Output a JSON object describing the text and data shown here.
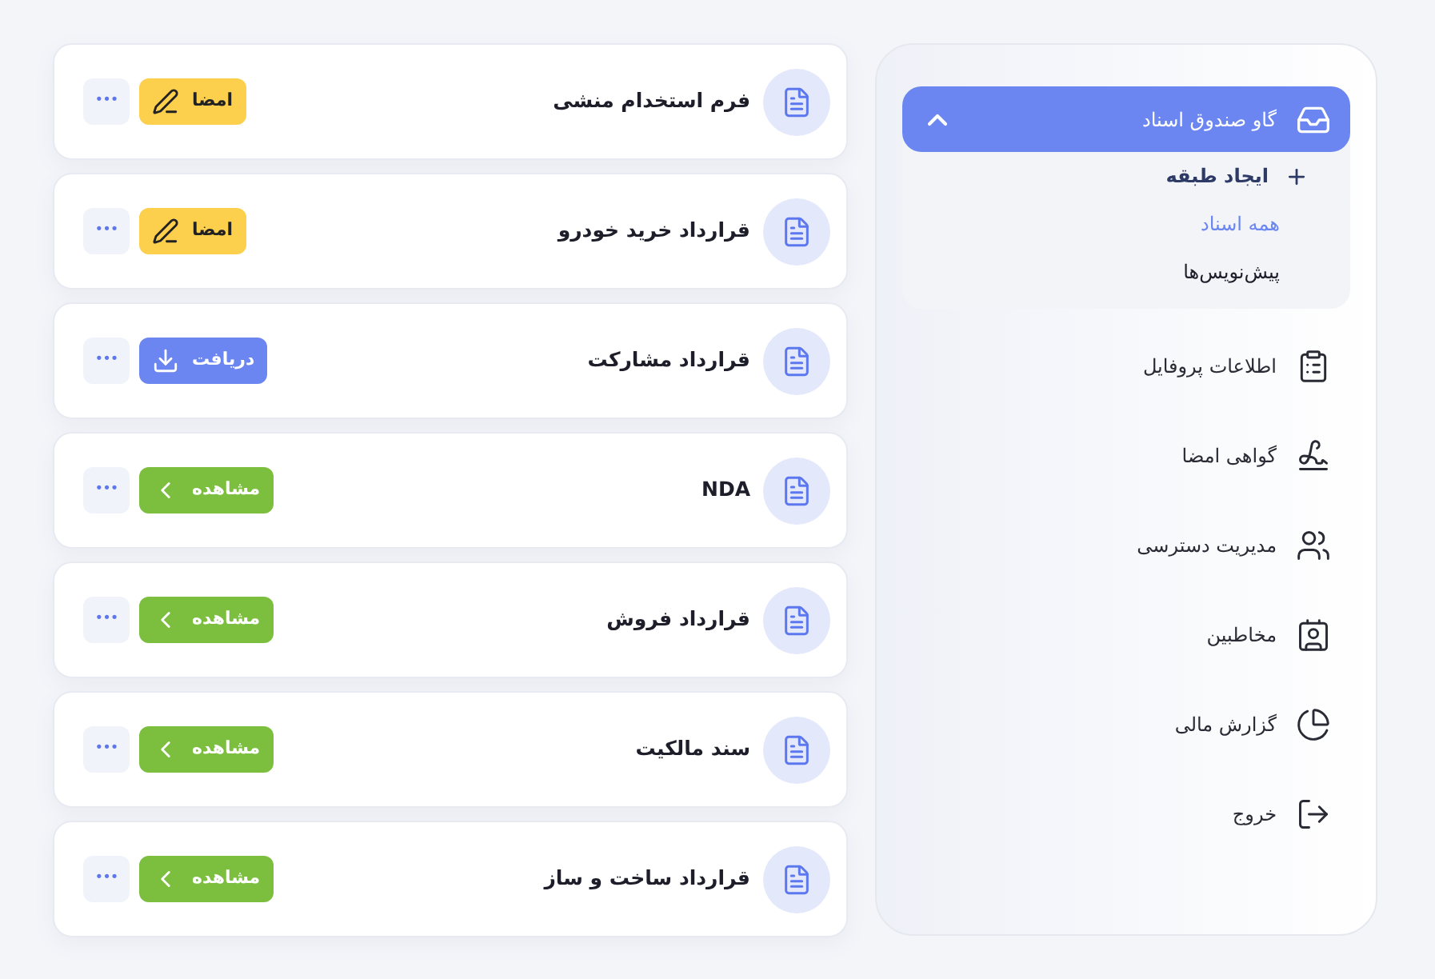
{
  "documents": [
    {
      "title": "فرم استخدام منشی",
      "action": {
        "kind": "sign",
        "label": "امضا"
      },
      "more": "•••"
    },
    {
      "title": "قرارداد خرید خودرو",
      "action": {
        "kind": "sign",
        "label": "امضا"
      },
      "more": "•••"
    },
    {
      "title": "قرارداد مشارکت",
      "action": {
        "kind": "download",
        "label": "دریافت"
      },
      "more": "•••"
    },
    {
      "title": "NDA",
      "action": {
        "kind": "view",
        "label": "مشاهده"
      },
      "more": "•••"
    },
    {
      "title": "قرارداد فروش",
      "action": {
        "kind": "view",
        "label": "مشاهده"
      },
      "more": "•••"
    },
    {
      "title": "سند مالکیت",
      "action": {
        "kind": "view",
        "label": "مشاهده"
      },
      "more": "•••"
    },
    {
      "title": "قرارداد ساخت و ساز",
      "action": {
        "kind": "view",
        "label": "مشاهده"
      },
      "more": "•••"
    }
  ],
  "sidebar": {
    "group": {
      "label": "گاو صندوق اسناد",
      "expanded": true,
      "children": [
        {
          "label": "ایجاد طبقه",
          "kind": "add",
          "selected": false
        },
        {
          "label": "همه اسناد",
          "kind": "link",
          "selected": true
        },
        {
          "label": "پیش‌نویس‌ها",
          "kind": "link",
          "selected": false
        }
      ]
    },
    "items": [
      {
        "label": "اطلاعات پروفایل",
        "kind": "profile"
      },
      {
        "label": "گواهی امضا",
        "kind": "signature"
      },
      {
        "label": "مدیریت دسترسی",
        "kind": "access"
      },
      {
        "label": "مخاطبین",
        "kind": "contacts"
      },
      {
        "label": "گزارش مالی",
        "kind": "finance"
      },
      {
        "label": "خروج",
        "kind": "logout"
      }
    ]
  }
}
